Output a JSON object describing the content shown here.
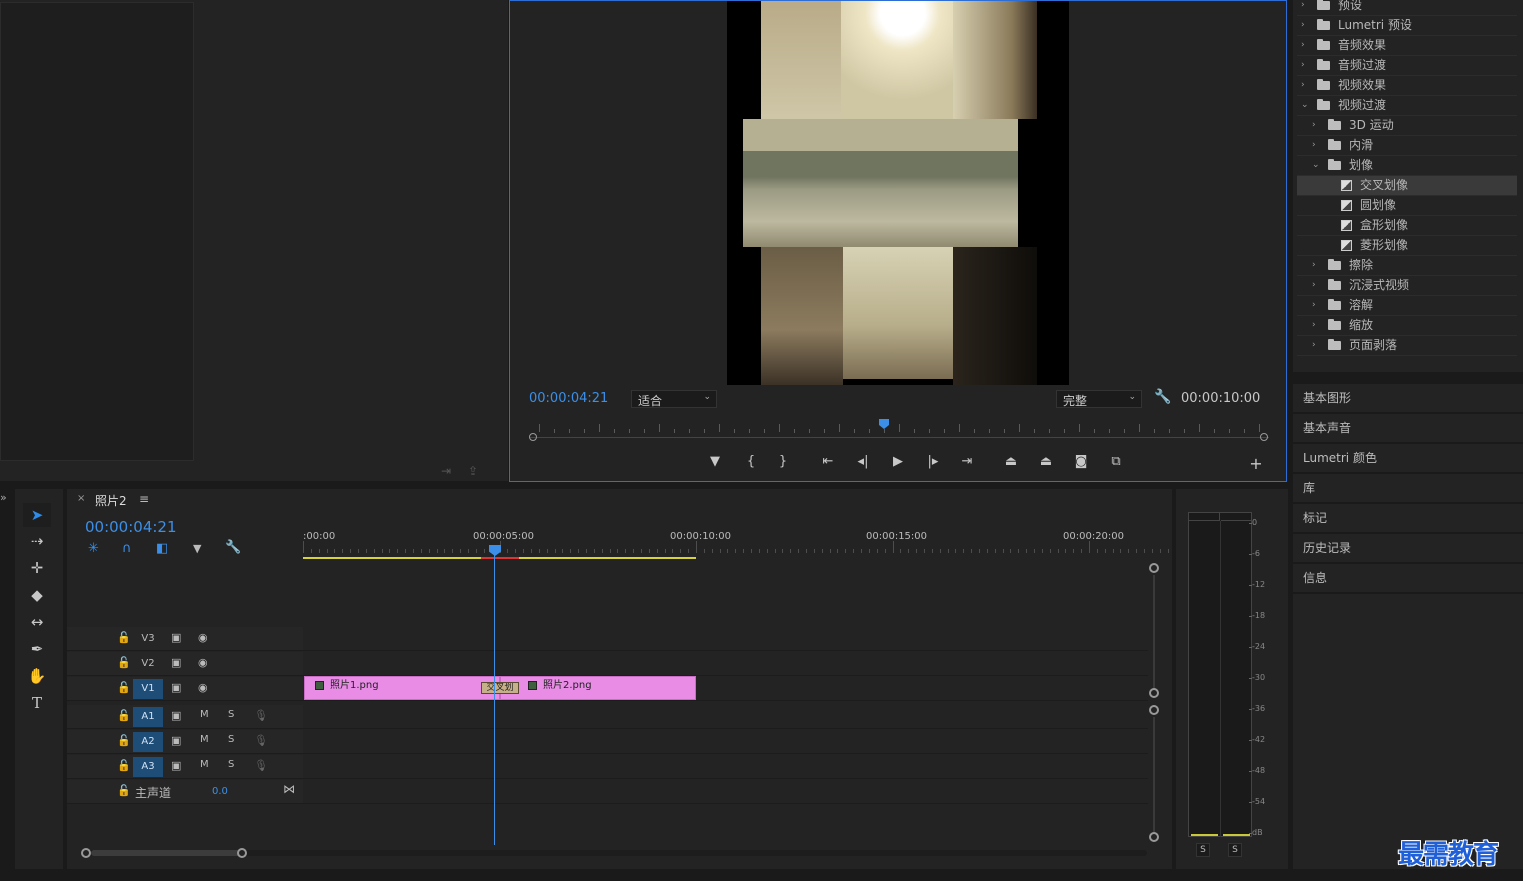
{
  "program": {
    "timecode": "00:00:04:21",
    "fit_value": "适合",
    "quality_value": "完整",
    "duration": "00:00:10:00"
  },
  "effects": {
    "items": [
      {
        "label": "预设",
        "depth": 0,
        "expanded": false,
        "kind": "preset"
      },
      {
        "label": "Lumetri 预设",
        "depth": 0,
        "expanded": false,
        "kind": "preset"
      },
      {
        "label": "音频效果",
        "depth": 0,
        "expanded": false,
        "kind": "folder"
      },
      {
        "label": "音频过渡",
        "depth": 0,
        "expanded": false,
        "kind": "folder"
      },
      {
        "label": "视频效果",
        "depth": 0,
        "expanded": false,
        "kind": "folder"
      },
      {
        "label": "视频过渡",
        "depth": 0,
        "expanded": true,
        "kind": "folder"
      },
      {
        "label": "3D 运动",
        "depth": 1,
        "expanded": false,
        "kind": "folder"
      },
      {
        "label": "内滑",
        "depth": 1,
        "expanded": false,
        "kind": "folder"
      },
      {
        "label": "划像",
        "depth": 1,
        "expanded": true,
        "kind": "folder"
      },
      {
        "label": "交叉划像",
        "depth": 2,
        "kind": "transition",
        "selected": true
      },
      {
        "label": "圆划像",
        "depth": 2,
        "kind": "transition"
      },
      {
        "label": "盒形划像",
        "depth": 2,
        "kind": "transition"
      },
      {
        "label": "菱形划像",
        "depth": 2,
        "kind": "transition"
      },
      {
        "label": "擦除",
        "depth": 1,
        "expanded": false,
        "kind": "folder"
      },
      {
        "label": "沉浸式视频",
        "depth": 1,
        "expanded": false,
        "kind": "folder"
      },
      {
        "label": "溶解",
        "depth": 1,
        "expanded": false,
        "kind": "folder"
      },
      {
        "label": "缩放",
        "depth": 1,
        "expanded": false,
        "kind": "folder"
      },
      {
        "label": "页面剥落",
        "depth": 1,
        "expanded": false,
        "kind": "folder"
      }
    ]
  },
  "side_panels": [
    "基本图形",
    "基本声音",
    "Lumetri 颜色",
    "库",
    "标记",
    "历史记录",
    "信息"
  ],
  "timeline": {
    "sequence_name": "照片2",
    "timecode": "00:00:04:21",
    "ruler_labels": [
      ":00:00",
      "00:00:05:00",
      "00:00:10:00",
      "00:00:15:00",
      "00:00:20:00"
    ],
    "video_tracks": [
      "V3",
      "V2",
      "V1"
    ],
    "audio_tracks": [
      "A1",
      "A2",
      "A3"
    ],
    "audio_m": "M",
    "audio_s": "S",
    "master_label": "主声道",
    "master_value": "0.0",
    "clips": {
      "clip1": "照片1.png",
      "clip2": "照片2.png",
      "transition": "交叉划"
    }
  },
  "meter": {
    "scale": [
      "0",
      "-6",
      "-12",
      "-18",
      "-24",
      "-30",
      "-36",
      "-42",
      "-48",
      "-54",
      "dB"
    ],
    "solo_left": "S",
    "solo_right": "S"
  },
  "watermark": "最需教育"
}
